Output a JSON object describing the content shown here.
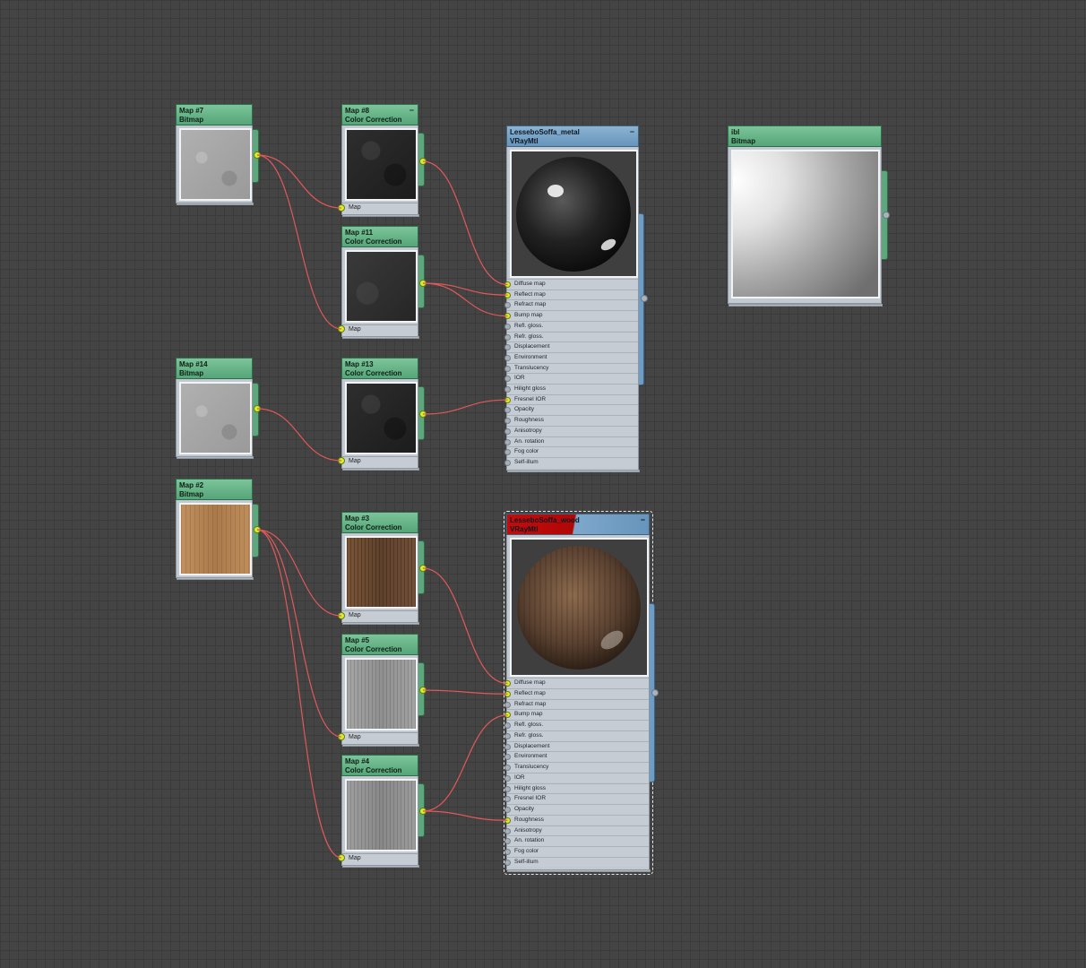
{
  "map_nodes": [
    {
      "id": "m7",
      "title": "Map #7",
      "type": "Bitmap",
      "texture": "grey-concrete",
      "color": "#a7a7a7",
      "has_input": false
    },
    {
      "id": "m8",
      "title": "Map #8",
      "type": "Color Correction",
      "texture": "dark-concrete",
      "color": "#262626",
      "has_input": true,
      "input_label": "Map"
    },
    {
      "id": "m11",
      "title": "Map #11",
      "type": "Color Correction",
      "texture": "dark-concrete",
      "color": "#313131",
      "has_input": true,
      "input_label": "Map"
    },
    {
      "id": "m14",
      "title": "Map #14",
      "type": "Bitmap",
      "texture": "grey-concrete",
      "color": "#a3a3a3",
      "has_input": false
    },
    {
      "id": "m13",
      "title": "Map #13",
      "type": "Color Correction",
      "texture": "dark-concrete",
      "color": "#2b2b2b",
      "has_input": true,
      "input_label": "Map"
    },
    {
      "id": "m2",
      "title": "Map #2",
      "type": "Bitmap",
      "texture": "light-wood",
      "color": "#b68457",
      "has_input": false
    },
    {
      "id": "m3",
      "title": "Map #3",
      "type": "Color Correction",
      "texture": "dark-wood",
      "color": "#6f4d33",
      "has_input": true,
      "input_label": "Map"
    },
    {
      "id": "m5",
      "title": "Map #5",
      "type": "Color Correction",
      "texture": "grey-wood",
      "color": "#9b9b9b",
      "has_input": true,
      "input_label": "Map"
    },
    {
      "id": "m4",
      "title": "Map #4",
      "type": "Color Correction",
      "texture": "grey-wood",
      "color": "#949494",
      "has_input": true,
      "input_label": "Map"
    }
  ],
  "ibl_node": {
    "title": "ibl",
    "type": "Bitmap",
    "texture": "white-to-grey-gradient"
  },
  "material_nodes": [
    {
      "id": "metal",
      "title": "LesseboSoffa_metal",
      "type": "VRayMtl",
      "selected": false,
      "preview": "glossy-black-sphere",
      "slots": [
        "Diffuse map",
        "Reflect map",
        "Refract map",
        "Bump map",
        "Refl. gloss.",
        "Refr. gloss.",
        "Displacement",
        "Environment",
        "Translucency",
        "IOR",
        "Hilight gloss",
        "Fresnel IOR",
        "Opacity",
        "Roughness",
        "Anisotropy",
        "An. rotation",
        "Fog color",
        "Self-illum"
      ],
      "connected_slots": [
        "Diffuse map",
        "Reflect map",
        "Bump map",
        "Fresnel IOR"
      ]
    },
    {
      "id": "wood",
      "title": "LesseboSoffa_wood",
      "type": "VRayMtl",
      "selected": true,
      "preview": "wood-sphere",
      "slots": [
        "Diffuse map",
        "Reflect map",
        "Refract map",
        "Bump map",
        "Refl. gloss.",
        "Refr. gloss.",
        "Displacement",
        "Environment",
        "Translucency",
        "IOR",
        "Hilight gloss",
        "Fresnel IOR",
        "Opacity",
        "Roughness",
        "Anisotropy",
        "An. rotation",
        "Fog color",
        "Self-illum"
      ],
      "connected_slots": [
        "Diffuse map",
        "Reflect map",
        "Bump map",
        "Roughness"
      ]
    }
  ],
  "connections": [
    {
      "from": "m7",
      "to": "m8"
    },
    {
      "from": "m7",
      "to": "m11"
    },
    {
      "from": "m14",
      "to": "m13"
    },
    {
      "from": "m2",
      "to": "m3"
    },
    {
      "from": "m2",
      "to": "m5"
    },
    {
      "from": "m2",
      "to": "m4"
    },
    {
      "from": "m8",
      "to": "metal",
      "slot": "Diffuse map"
    },
    {
      "from": "m11",
      "to": "metal",
      "slot": "Reflect map"
    },
    {
      "from": "m11",
      "to": "metal",
      "slot": "Bump map"
    },
    {
      "from": "m13",
      "to": "metal",
      "slot": "Fresnel IOR"
    },
    {
      "from": "m3",
      "to": "wood",
      "slot": "Diffuse map"
    },
    {
      "from": "m5",
      "to": "wood",
      "slot": "Reflect map"
    },
    {
      "from": "m4",
      "to": "wood",
      "slot": "Bump map"
    },
    {
      "from": "m4",
      "to": "wood",
      "slot": "Roughness"
    }
  ],
  "colors": {
    "wire": "#e0585a",
    "port_active": "#d5ef2a",
    "map_header": "#6ab68a",
    "material_header": "#7aa6c9",
    "selected_header": "#c00a0a",
    "canvas": "#444444"
  }
}
